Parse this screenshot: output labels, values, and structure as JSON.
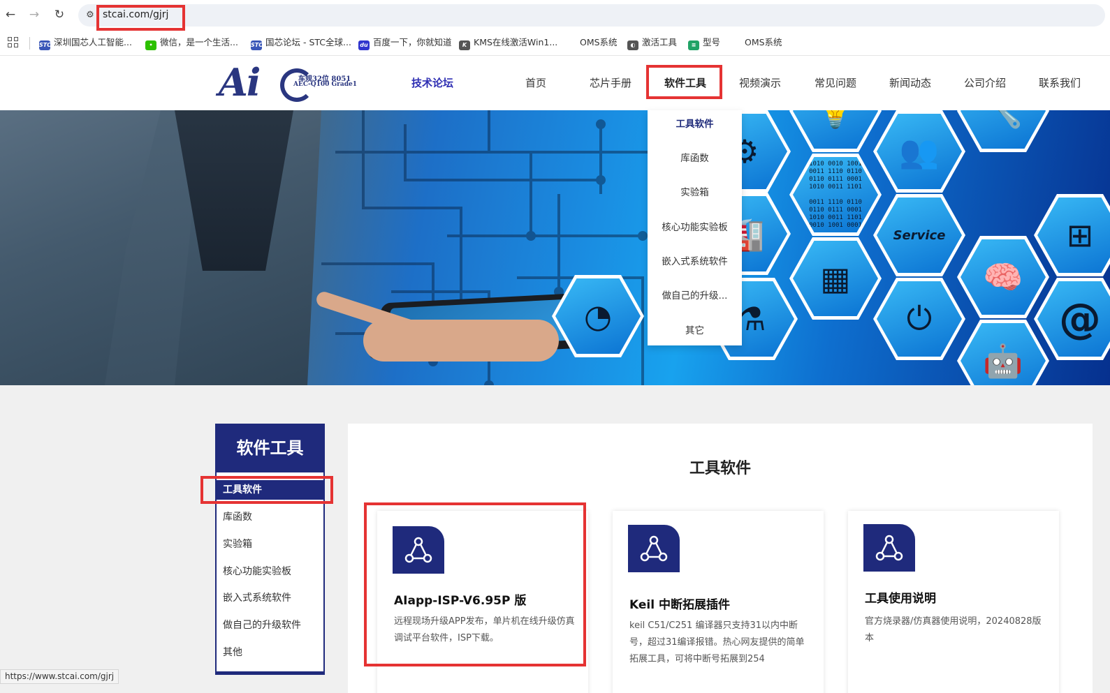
{
  "browser": {
    "url": "stcai.com/gjrj",
    "status_url": "https://www.stcai.com/gjrj"
  },
  "bookmarks": [
    {
      "label": "深圳国芯人工智能...",
      "fav": "STC",
      "color": "#3a57b8"
    },
    {
      "label": "微信，是一个生活...",
      "fav": "•",
      "color": "#2dc100"
    },
    {
      "label": "国芯论坛 - STC全球...",
      "fav": "STC",
      "color": "#3a57b8"
    },
    {
      "label": "百度一下，你就知道",
      "fav": "du",
      "color": "#3035ce"
    },
    {
      "label": "KMS在线激活Win1...",
      "fav": "K",
      "color": "#555555"
    },
    {
      "label": "OMS系统",
      "fav": "",
      "color": "#ffffff"
    },
    {
      "label": "激活工具",
      "fav": "◐",
      "color": "#555555"
    },
    {
      "label": "型号",
      "fav": "≡",
      "color": "#21a366"
    },
    {
      "label": "OMS系统",
      "fav": "",
      "color": "#ffffff"
    }
  ],
  "logo": {
    "mark": "Ai",
    "line1": "车规32位 8051",
    "line2": "AEC-Q100 Grade1"
  },
  "menu": [
    {
      "label": "技术论坛"
    },
    {
      "label": "首页"
    },
    {
      "label": "芯片手册"
    },
    {
      "label": "软件工具"
    },
    {
      "label": "视频演示"
    },
    {
      "label": "常见问题"
    },
    {
      "label": "新闻动态"
    },
    {
      "label": "公司介绍"
    },
    {
      "label": "联系我们"
    }
  ],
  "dropdown": [
    {
      "label": "工具软件"
    },
    {
      "label": "库函数"
    },
    {
      "label": "实验箱"
    },
    {
      "label": "核心功能实验板"
    },
    {
      "label": "嵌入式系统软件"
    },
    {
      "label": "做自己的升级..."
    },
    {
      "label": "其它"
    }
  ],
  "banner": {
    "binary": "1010 0010 1001\n0011 1110 0110\n0110 0111 0001\n1010 0011 1101\n\n0011 1110 0110\n0110 0111 0001\n1010 0011 1101\n0010 1001 0001",
    "service": "Service",
    "at": "@"
  },
  "sidebar": {
    "title": "软件工具",
    "items": [
      {
        "label": "工具软件"
      },
      {
        "label": "库函数"
      },
      {
        "label": "实验箱"
      },
      {
        "label": "核心功能实验板"
      },
      {
        "label": "嵌入式系统软件"
      },
      {
        "label": "做自己的升级软件"
      },
      {
        "label": "其他"
      }
    ]
  },
  "main": {
    "title": "工具软件",
    "products": [
      {
        "title": "AIapp-ISP-V6.95P 版",
        "desc": "远程现场升级APP发布，单片机在线升级仿真调试平台软件，ISP下载。"
      },
      {
        "title": "Keil 中断拓展插件",
        "desc": "keil C51/C251 编译器只支持31以内中断号，超过31编译报错。热心网友提供的简单拓展工具，可将中断号拓展到254"
      },
      {
        "title": "工具使用说明",
        "desc": "官方烧录器/仿真器使用说明，20240828版本"
      }
    ]
  },
  "colors": {
    "brand": "#1f2a7c",
    "highlight": "#e53333"
  }
}
